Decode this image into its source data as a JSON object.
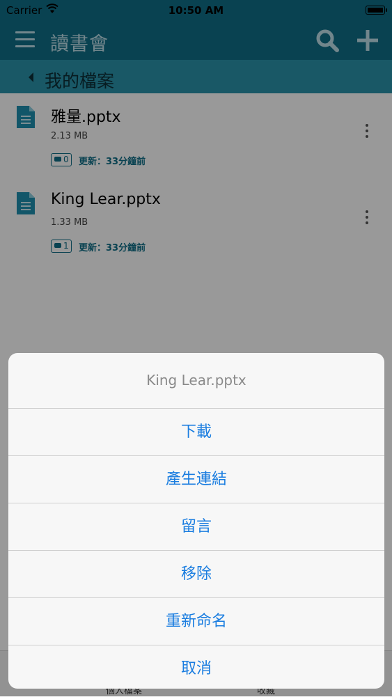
{
  "status_bar": {
    "carrier": "Carrier",
    "time": "10:50 AM"
  },
  "nav": {
    "title": "讀書會"
  },
  "breadcrumb": {
    "label": "我的檔案"
  },
  "files": [
    {
      "name": "雅量.pptx",
      "size": "2.13 MB",
      "comments": "0",
      "updated": "更新：33分鐘前"
    },
    {
      "name": "King Lear.pptx",
      "size": "1.33 MB",
      "comments": "1",
      "updated": "更新：33分鐘前"
    }
  ],
  "tabbar": {
    "left": "個人檔案",
    "right": "收藏"
  },
  "action_sheet": {
    "title": "King Lear.pptx",
    "options": [
      "下載",
      "產生連結",
      "留言",
      "移除",
      "重新命名",
      "取消"
    ]
  },
  "colors": {
    "navbar": "#0f6e87",
    "subbar": "#2a93ab",
    "action": "#1a7de0"
  }
}
